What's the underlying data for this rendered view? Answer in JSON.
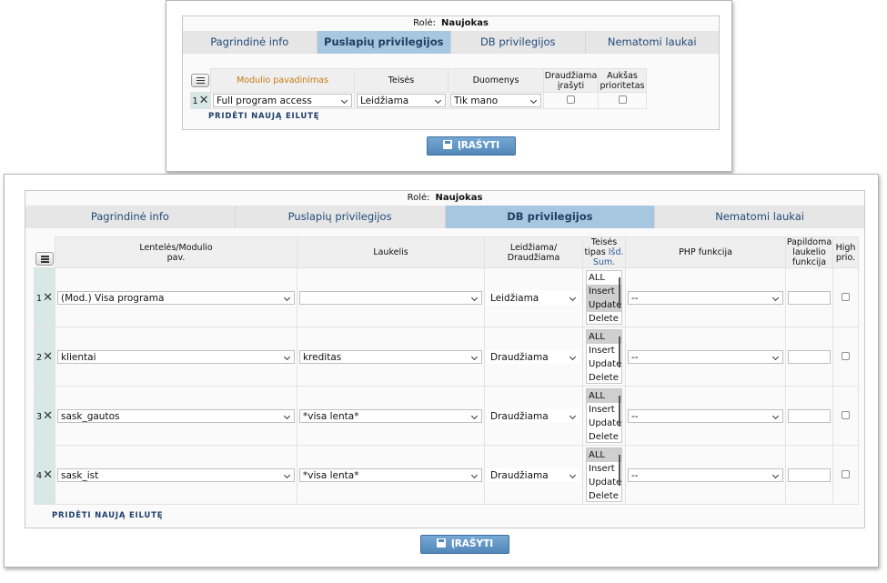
{
  "role_label": "Rolė:",
  "role_value": "Naujokas",
  "tabs": [
    "Pagrindinė info",
    "Puslapių privilegijos",
    "DB privilegijos",
    "Nematomi laukai"
  ],
  "add_row_label": "Pridėti naują eilutę",
  "save_label": "ĮRAŠYTI",
  "page_privileges": {
    "headers": {
      "module": "Modulio pavadinimas",
      "rights": "Teisės",
      "data": "Duomenys",
      "deny_write_1": "Draudžiama",
      "deny_write_2": "įrašyti",
      "high_priority_1": "Aukšas",
      "high_priority_2": "prioritetas"
    },
    "rows": [
      {
        "index": "1",
        "module": "Full program access",
        "rights": "Leidžiama",
        "data": "Tik mano",
        "deny_write": false,
        "high_priority": false
      }
    ]
  },
  "db_privileges": {
    "headers": {
      "table_1": "Lentelės/Modulio",
      "table_2": "pav.",
      "field": "Laukelis",
      "allow_1": "Leidžiama/",
      "allow_2": "Draudžiama",
      "right_type_1": "Teisės",
      "right_type_2": "tipas",
      "right_type_link_1": "Išd.",
      "right_type_link_2": "Sum.",
      "php": "PHP funkcija",
      "extra_1": "Papildoma",
      "extra_2": "laukelio",
      "extra_3": "funkcija",
      "high_1": "High",
      "high_2": "prio."
    },
    "right_options": [
      "ALL",
      "Insert",
      "Update",
      "Delete"
    ],
    "rows": [
      {
        "index": "1",
        "table": "(Mod.) Visa programa",
        "field": "",
        "allow": "Leidžiama",
        "selected_rights": [
          "Insert",
          "Update"
        ],
        "php": "--",
        "extra": "",
        "high_prio": false
      },
      {
        "index": "2",
        "table": "klientai",
        "field": "kreditas",
        "allow": "Draudžiama",
        "selected_rights": [
          "ALL"
        ],
        "php": "--",
        "extra": "",
        "high_prio": false
      },
      {
        "index": "3",
        "table": "sask_gautos",
        "field": "*visa lenta*",
        "allow": "Draudžiama",
        "selected_rights": [
          "ALL"
        ],
        "php": "--",
        "extra": "",
        "high_prio": false
      },
      {
        "index": "4",
        "table": "sask_ist",
        "field": "*visa lenta*",
        "allow": "Draudžiama",
        "selected_rights": [
          "ALL"
        ],
        "php": "--",
        "extra": "",
        "high_prio": false
      }
    ]
  }
}
